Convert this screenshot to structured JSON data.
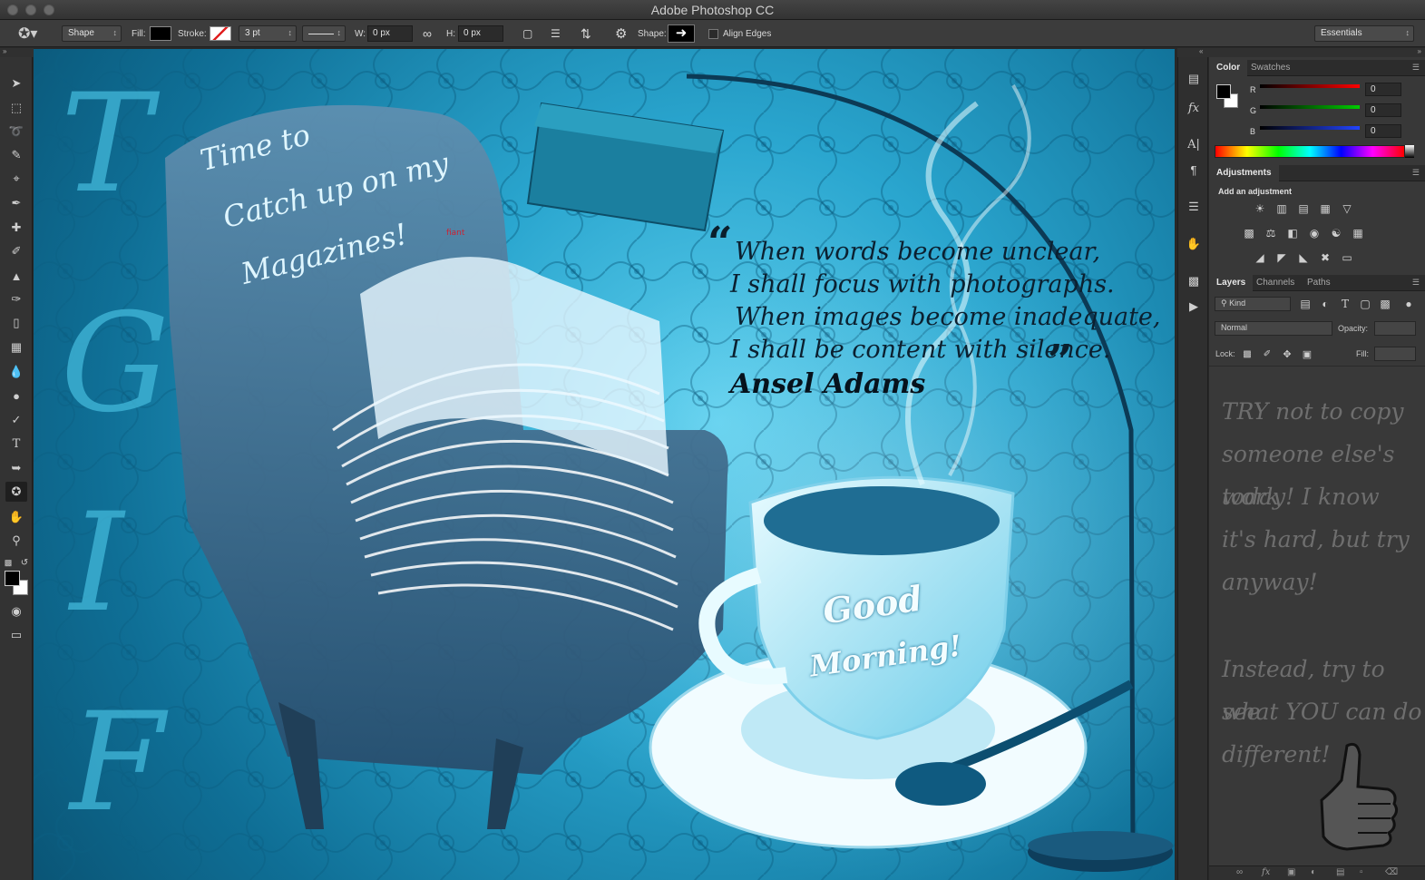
{
  "window": {
    "title": "Adobe Photoshop CC"
  },
  "options_bar": {
    "mode": "Shape",
    "fill_label": "Fill:",
    "stroke_label": "Stroke:",
    "stroke_width": "3 pt",
    "w_label": "W:",
    "w_value": "0 px",
    "h_label": "H:",
    "h_value": "0 px",
    "shape_label": "Shape:",
    "align_edges": "Align Edges",
    "workspace": "Essentials"
  },
  "canvas": {
    "chair_caption": [
      "Time to",
      "Catch up on my",
      "Magazines!"
    ],
    "quote_lines": [
      "When words become unclear,",
      "I shall focus with photographs.",
      "When images become inadequate,",
      "I shall be content with silence."
    ],
    "quote_author": "Ansel Adams",
    "cup_caption": [
      "Good",
      "Morning!"
    ],
    "side_letters": [
      "T",
      "G",
      "I",
      "F"
    ],
    "magazine_brand": "fiant"
  },
  "color_panel": {
    "tabs": [
      "Color",
      "Swatches"
    ],
    "channels": [
      {
        "label": "R",
        "value": "0",
        "color": "#e02020"
      },
      {
        "label": "G",
        "value": "0",
        "color": "#20c020"
      },
      {
        "label": "B",
        "value": "0",
        "color": "#2050ff"
      }
    ]
  },
  "adjustments_panel": {
    "tab": "Adjustments",
    "heading": "Add an adjustment"
  },
  "layers_panel": {
    "tabs": [
      "Layers",
      "Channels",
      "Paths"
    ],
    "filter_kind": "Kind",
    "blend_mode": "Normal",
    "opacity_label": "Opacity:",
    "lock_label": "Lock:",
    "fill_label": "Fill:",
    "note_lines": [
      "TRY not to copy",
      "someone else's work",
      "today! I know",
      "it's hard, but try",
      "anyway!",
      "",
      "Instead, try to see",
      "what YOU can do",
      "different!"
    ]
  },
  "colors": {
    "accent_cyan": "#2aa6cf",
    "panel_bg": "#383838"
  }
}
